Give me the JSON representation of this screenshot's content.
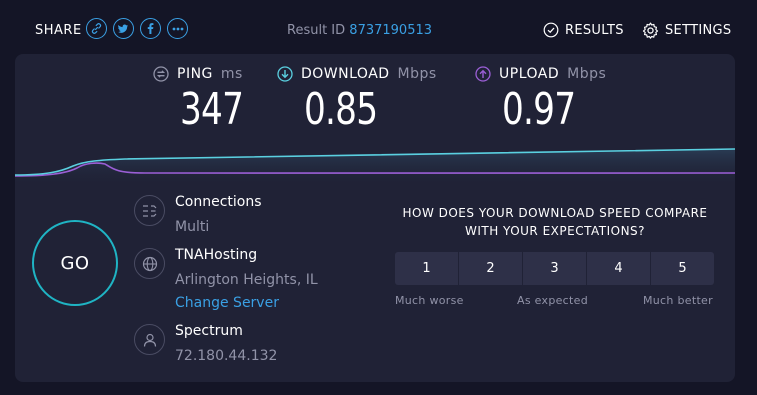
{
  "header": {
    "share_label": "SHARE",
    "share_icons": [
      "link-icon",
      "twitter-icon",
      "facebook-icon",
      "more-icon"
    ],
    "result_id_label": "Result ID",
    "result_id": "8737190513",
    "results_label": "RESULTS",
    "settings_label": "SETTINGS"
  },
  "metrics": {
    "ping": {
      "label": "PING",
      "unit": "ms",
      "value": "347"
    },
    "download": {
      "label": "DOWNLOAD",
      "unit": "Mbps",
      "value": "0.85"
    },
    "upload": {
      "label": "UPLOAD",
      "unit": "Mbps",
      "value": "0.97"
    }
  },
  "go_label": "GO",
  "connection": {
    "title": "Connections",
    "value": "Multi"
  },
  "server": {
    "host": "TNAHosting",
    "location": "Arlington Heights, IL",
    "change_label": "Change Server"
  },
  "isp": {
    "name": "Spectrum",
    "ip": "72.180.44.132"
  },
  "survey": {
    "question": "HOW DOES YOUR DOWNLOAD SPEED COMPARE WITH YOUR EXPECTATIONS?",
    "options": [
      "1",
      "2",
      "3",
      "4",
      "5"
    ],
    "low_label": "Much worse",
    "mid_label": "As expected",
    "high_label": "Much better"
  },
  "colors": {
    "accent": "#3aa0e4",
    "download": "#5ad0e0",
    "upload": "#9b5fd6",
    "go_ring": "#1fb4c4",
    "panel": "#202236",
    "background": "#141526"
  }
}
